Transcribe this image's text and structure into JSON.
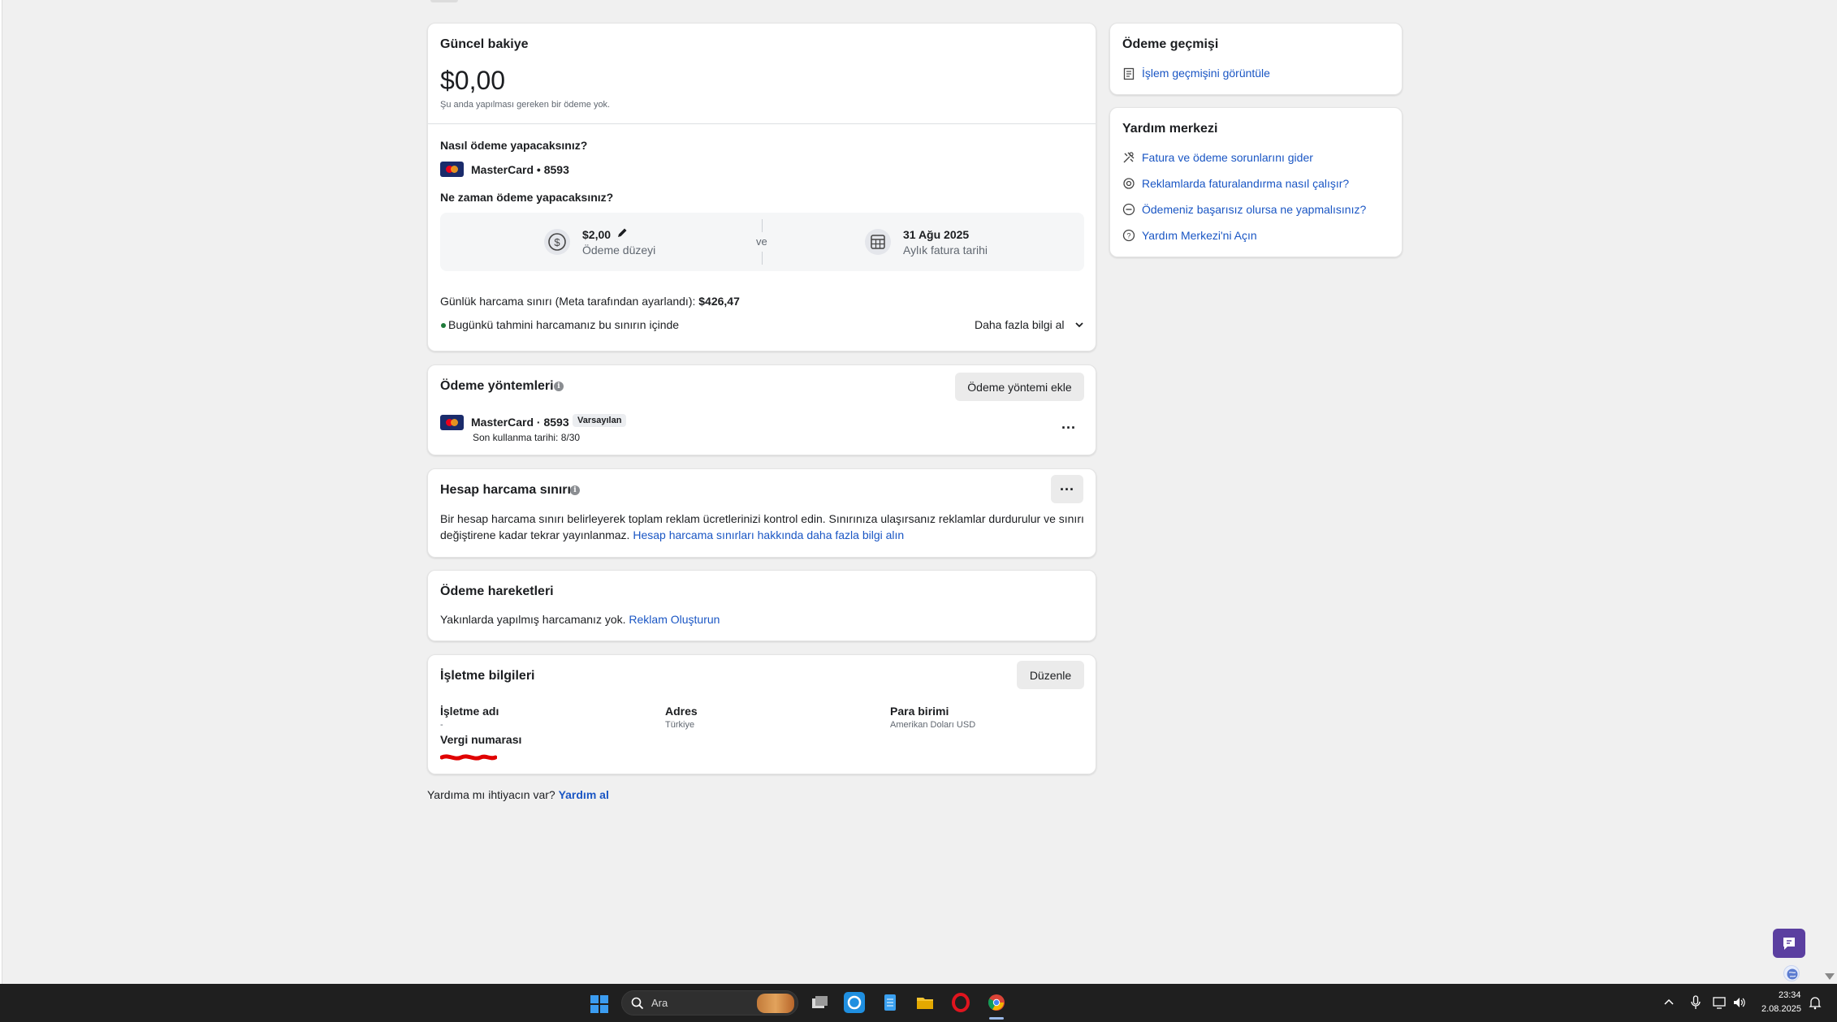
{
  "balance": {
    "title": "Güncel bakiye",
    "amount": "$0,00",
    "note": "Şu anda yapılması gereken bir ödeme yok.",
    "how_title": "Nasıl ödeme yapacaksınız?",
    "card_label": "MasterCard • 8593",
    "when_title": "Ne zaman ödeme yapacaksınız?",
    "threshold_value": "$2,00",
    "threshold_label": "Ödeme düzeyi",
    "and_label": "ve",
    "bill_date": "31 Ağu 2025",
    "bill_label": "Aylık fatura tarihi",
    "daily_limit_text": "Günlük harcama sınırı (Meta tarafından ayarlandı): ",
    "daily_limit_value": "$426,47",
    "status_text": "Bugünkü tahmini harcamanız bu sınırın içinde",
    "more_info": "Daha fazla bilgi al"
  },
  "payment_methods": {
    "title": "Ödeme yöntemleri",
    "add_button": "Ödeme yöntemi ekle",
    "card_label": "MasterCard · 8593",
    "default_badge": "Varsayılan",
    "expiry": "Son kullanma tarihi: 8/30",
    "more": "..."
  },
  "account_limit": {
    "title": "Hesap harcama sınırı",
    "more": "...",
    "desc_line1": "Bir hesap harcama sınırı belirleyerek toplam reklam ücretlerinizi kontrol edin. Sınırınıza ulaşırsanız reklamlar durdurulur ve sınırı",
    "desc_line2": "değiştirene kadar tekrar yayınlanmaz. ",
    "link": "Hesap harcama sınırları hakkında daha fazla bilgi alın"
  },
  "activity": {
    "title": "Ödeme hareketleri",
    "text": "Yakınlarda yapılmış harcamanız yok. ",
    "link": "Reklam Oluşturun"
  },
  "business": {
    "title": "İşletme bilgileri",
    "edit_button": "Düzenle",
    "name_label": "İşletme adı",
    "name_value": "-",
    "address_label": "Adres",
    "address_value": "Türkiye",
    "currency_label": "Para birimi",
    "currency_value": "Amerikan Doları USD",
    "tax_label": "Vergi numarası"
  },
  "help_footer": {
    "text": "Yardıma mı ihtiyacın var? ",
    "link": "Yardım al"
  },
  "history": {
    "title": "Ödeme geçmişi",
    "link": "İşlem geçmişini görüntüle"
  },
  "help_center": {
    "title": "Yardım merkezi",
    "links": [
      "Fatura ve ödeme sorunlarını gider",
      "Reklamlarda faturalandırma nasıl çalışır?",
      "Ödemeniz başarısız olursa ne yapmalısınız?",
      "Yardım Merkezi'ni Açın"
    ]
  },
  "taskbar": {
    "search_placeholder": "Ara",
    "time": "23:34",
    "date": "2.08.2025"
  },
  "colors": {
    "link": "#1a56c4",
    "taskbar": "#1f1f1f",
    "chat_button": "#5b3fa0",
    "redaction": "#e00000"
  }
}
